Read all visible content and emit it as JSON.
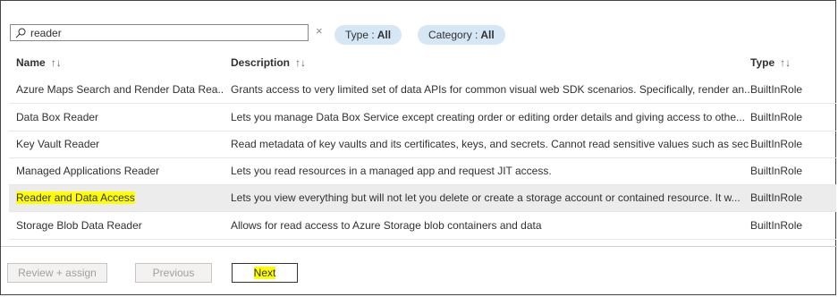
{
  "search": {
    "value": "reader",
    "clear_label": "×"
  },
  "filters": {
    "type_label": "Type :",
    "type_value": "All",
    "category_label": "Category :",
    "category_value": "All"
  },
  "columns": {
    "name": "Name",
    "description": "Description",
    "type": "Type",
    "name_sort": "↑↓",
    "description_sort": "↑↓",
    "type_sort": "↑↓"
  },
  "rows": [
    {
      "name": "Azure Maps Search and Render Data Rea...",
      "description": "Grants access to very limited set of data APIs for common visual web SDK scenarios. Specifically, render an...",
      "type": "BuiltInRole"
    },
    {
      "name": "Data Box Reader",
      "description": "Lets you manage Data Box Service except creating order or editing order details and giving access to othe...",
      "type": "BuiltInRole"
    },
    {
      "name": "Key Vault Reader",
      "description": "Read metadata of key vaults and its certificates, keys, and secrets. Cannot read sensitive values such as sec...",
      "type": "BuiltInRole"
    },
    {
      "name": "Managed Applications Reader",
      "description": "Lets you read resources in a managed app and request JIT access.",
      "type": "BuiltInRole"
    },
    {
      "name": "Reader and Data Access",
      "description": "Lets you view everything but will not let you delete or create a storage account or contained resource. It w...",
      "type": "BuiltInRole"
    },
    {
      "name": "Storage Blob Data Reader",
      "description": "Allows for read access to Azure Storage blob containers and data",
      "type": "BuiltInRole"
    }
  ],
  "buttons": {
    "review_assign": "Review + assign",
    "previous": "Previous",
    "next": "Next"
  },
  "colors": {
    "pill": "#d5e6f5",
    "selected_row": "#ececec",
    "highlight": "#ffff00"
  }
}
